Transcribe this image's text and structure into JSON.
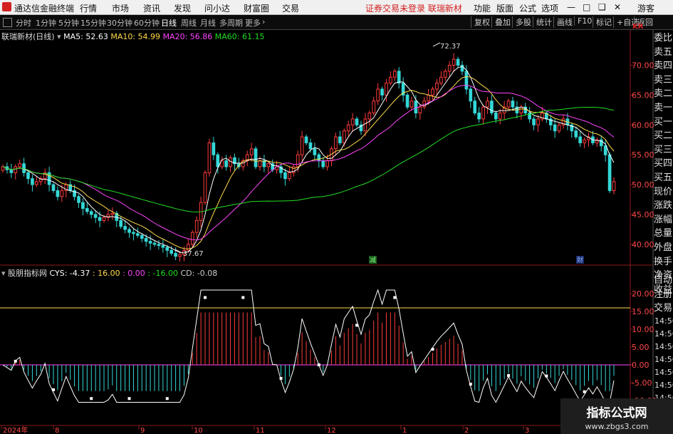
{
  "menubar": {
    "app_title": "通达信金融终端",
    "items": [
      "行情",
      "市场",
      "资讯",
      "发现",
      "问小达",
      "财富圈",
      "交易"
    ],
    "notice": "证券交易未登录  联瑞新材",
    "right_items": [
      "功能",
      "版面",
      "公式",
      "选项"
    ],
    "guest": "游客"
  },
  "toolbar": {
    "periods": [
      "分时",
      "1分钟",
      "5分钟",
      "15分钟",
      "30分钟",
      "60分钟",
      "日线",
      "周线",
      "月线",
      "多周期",
      "更多"
    ],
    "active_period": "日线",
    "right_buttons": [
      "复权",
      "叠加",
      "多股",
      "统计",
      "画线",
      "F10",
      "标记",
      "+自选",
      "返回"
    ]
  },
  "main_chart": {
    "stock_name": "联瑞新材(日线)",
    "ma": [
      {
        "label": "MA5: 52.63",
        "color": "#ffffff"
      },
      {
        "label": "MA10: 54.99",
        "color": "#ffd94a"
      },
      {
        "label": "MA20: 56.86",
        "color": "#ff44ff"
      },
      {
        "label": "MA60: 61.15",
        "color": "#22dd22"
      }
    ],
    "high_label": "72.37",
    "low_label": "37.67",
    "event_markers": [
      "减",
      "财"
    ],
    "y_ticks": [
      "70.00",
      "65.00",
      "60.00",
      "55.00",
      "50.00",
      "45.00",
      "40.00"
    ],
    "corner_tag": "KR"
  },
  "indicator": {
    "name": "股朋指标网",
    "values": [
      {
        "label": "CYS: -4.37",
        "color": "#ffffff"
      },
      {
        "label": ": 16.00",
        "color": "#ffd94a"
      },
      {
        "label": ": 0.00",
        "color": "#ff44ff"
      },
      {
        "label": ": -16.00",
        "color": "#22dd22"
      },
      {
        "label": "CD: -0.08",
        "color": "#cccccc"
      }
    ],
    "y_ticks": [
      "20.00",
      "15.00",
      "10.00",
      "5.00",
      "0.00",
      "-5.00",
      "-10.00"
    ],
    "right_times": [
      "14:56",
      "14:56",
      "14:56",
      "14:56",
      "14:56",
      "14:56",
      "14:56",
      "14:56"
    ]
  },
  "x_axis": {
    "labels": [
      "2024年",
      "8",
      "9",
      "10",
      "11",
      "12",
      "1",
      "2",
      "3"
    ]
  },
  "right_panel": {
    "top_items": [
      "委比",
      "卖五",
      "卖四",
      "卖三",
      "卖二",
      "卖一",
      "买一",
      "买二",
      "买三",
      "买四",
      "买五",
      "现价",
      "涨跌",
      "涨幅",
      "总量",
      "外盘",
      "换手",
      "净资",
      "收益"
    ],
    "bottom_items": [
      "自动",
      "注册",
      "交易"
    ]
  },
  "watermark": {
    "title": "指标公式网",
    "url": "www.zbgs3.com"
  },
  "chart_data": {
    "type": "candlestick",
    "title": "联瑞新材(日线)",
    "price_axis": {
      "ylim": [
        37,
        74
      ],
      "ticks": [
        70,
        65,
        60,
        55,
        50,
        45,
        40
      ]
    },
    "x_labels": [
      "2024年",
      "8",
      "9",
      "10",
      "11",
      "12",
      "1",
      "2",
      "3"
    ],
    "annotations": {
      "high": 72.37,
      "low": 37.67
    },
    "ma_last": {
      "MA5": 52.63,
      "MA10": 54.99,
      "MA20": 56.86,
      "MA60": 61.15
    },
    "closes": [
      53,
      52.5,
      52,
      53,
      53.5,
      52,
      51,
      50,
      50.5,
      51,
      52,
      50,
      49,
      48,
      49,
      50,
      49,
      48,
      47,
      46,
      45.5,
      45,
      44.5,
      44,
      44.5,
      45,
      45.2,
      44,
      43,
      42.5,
      42,
      41.8,
      41.5,
      41,
      40.5,
      40.2,
      40,
      39.8,
      39.5,
      39,
      38.5,
      38,
      38.3,
      39,
      40,
      42,
      44,
      47,
      52,
      57,
      55,
      53,
      54,
      53,
      54.5,
      53.5,
      53,
      54,
      55,
      56,
      53,
      54,
      53,
      53.5,
      52.5,
      53,
      52,
      51,
      52,
      53,
      55,
      58,
      57,
      56,
      55,
      54,
      53,
      54,
      56,
      58,
      57,
      59,
      60,
      61,
      60,
      59,
      61,
      62,
      64,
      66,
      65,
      67,
      68,
      69,
      67,
      65,
      63,
      64,
      62,
      63,
      64,
      65,
      66,
      67,
      68,
      69,
      70,
      71,
      70,
      69,
      66,
      64,
      62,
      61,
      63,
      64,
      62,
      61,
      62,
      63,
      64,
      63,
      62,
      63,
      62,
      61,
      60,
      61,
      62,
      61,
      60,
      59,
      60,
      61,
      60,
      59,
      58,
      57,
      57.5,
      58,
      57,
      57.5,
      56.5,
      55,
      49,
      50.5
    ],
    "indicator": {
      "name": "股朋指标网",
      "CYS": -4.37,
      "upper": 16.0,
      "zero": 0.0,
      "lower": -16.0,
      "CD": -0.08,
      "ylim": [
        -11,
        24
      ],
      "ticks": [
        20,
        15,
        10,
        5,
        0,
        -5,
        -10
      ]
    }
  }
}
